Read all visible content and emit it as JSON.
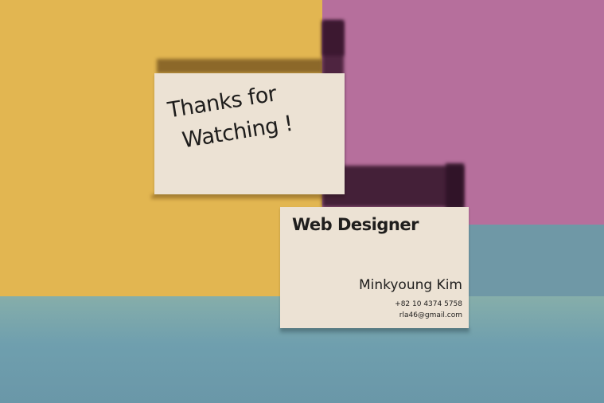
{
  "colors": {
    "yellow": "#e2b651",
    "pink": "#b66f9c",
    "teal": "#6f98a6",
    "card": "#ece2d4",
    "ink": "#1f1e1d"
  },
  "card_thanks": {
    "line1": "Thanks for",
    "line2": "Watching !"
  },
  "card_contact": {
    "title": "Web Designer",
    "name": "Minkyoung Kim",
    "phone": "+82 10 4374 5758",
    "email": "rla46@gmail.com"
  }
}
